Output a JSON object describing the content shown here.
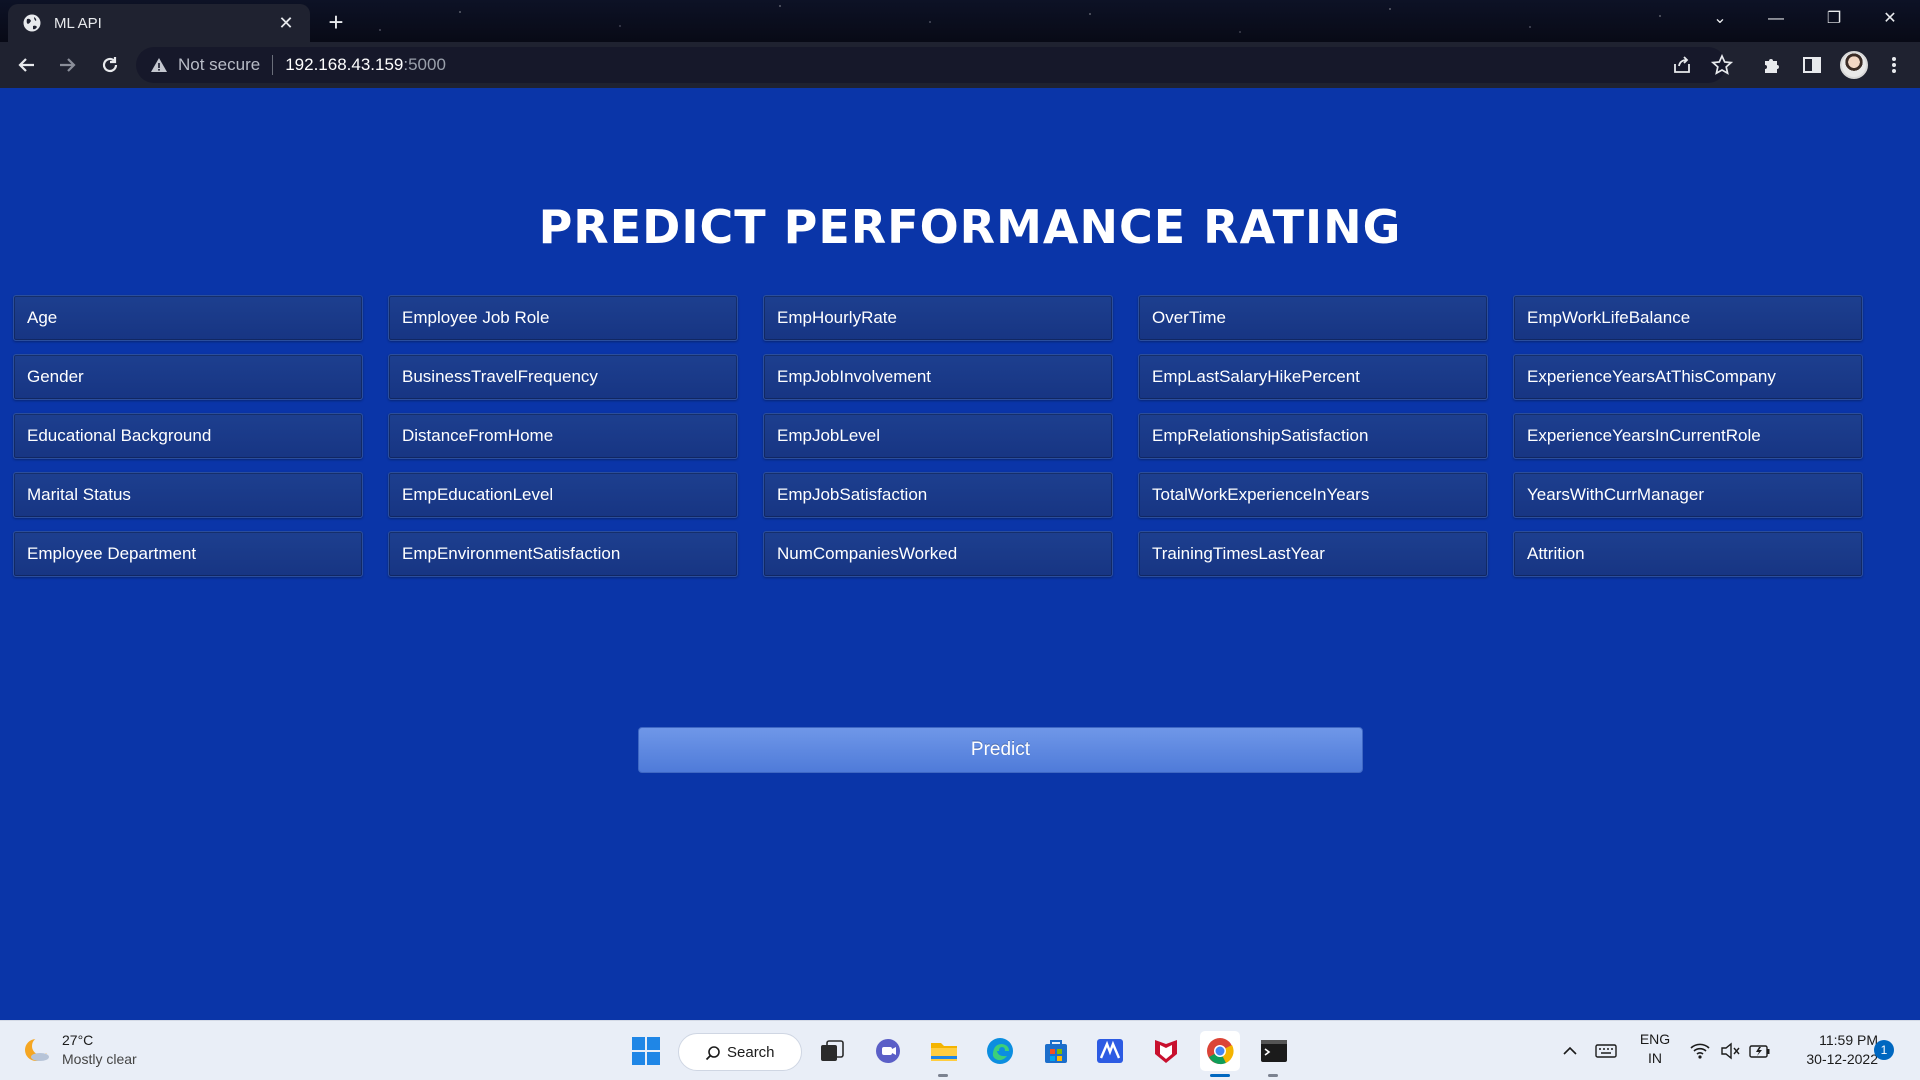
{
  "browser": {
    "tab_title": "ML API",
    "security_label": "Not secure",
    "url_host": "192.168.43.159",
    "url_port": ":5000"
  },
  "page": {
    "title": "PREDICT PERFORMANCE RATING",
    "fields": [
      "Age",
      "Employee Job Role",
      "EmpHourlyRate",
      "OverTime",
      "EmpWorkLifeBalance",
      "Gender",
      "BusinessTravelFrequency",
      "EmpJobInvolvement",
      "EmpLastSalaryHikePercent",
      "ExperienceYearsAtThisCompany",
      "Educational Background",
      "DistanceFromHome",
      "EmpJobLevel",
      "EmpRelationshipSatisfaction",
      "ExperienceYearsInCurrentRole",
      "Marital Status",
      "EmpEducationLevel",
      "EmpJobSatisfaction",
      "TotalWorkExperienceInYears",
      "YearsWithCurrManager",
      "Employee Department",
      "EmpEnvironmentSatisfaction",
      "NumCompaniesWorked",
      "TrainingTimesLastYear",
      "Attrition"
    ],
    "predict_label": "Predict"
  },
  "taskbar": {
    "weather_temp": "27°C",
    "weather_desc": "Mostly clear",
    "search_label": "Search",
    "lang_line1": "ENG",
    "lang_line2": "IN",
    "time": "11:59 PM",
    "date": "30-12-2022",
    "notification_count": "1"
  }
}
